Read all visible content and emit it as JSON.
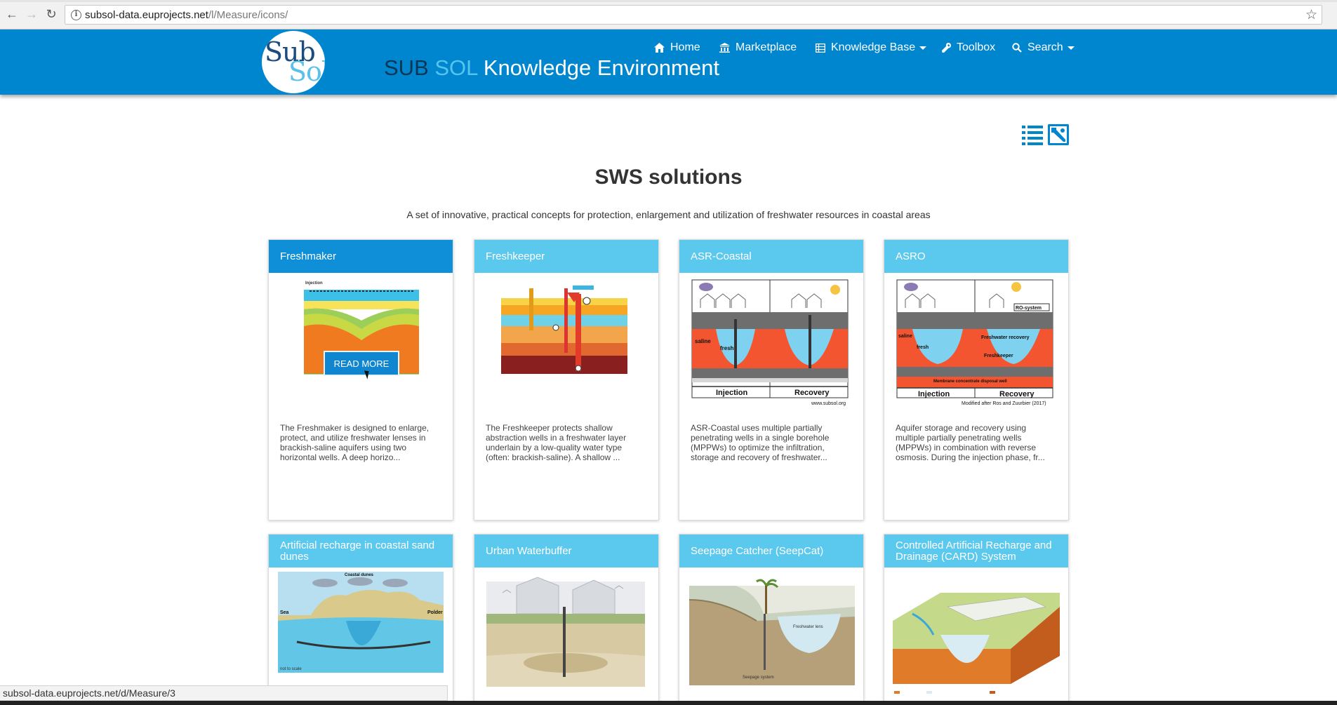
{
  "browser": {
    "url_host": "subsol-data.euprojects.net",
    "url_path": "/l/Measure/icons/",
    "status_url": "subsol-data.euprojects.net/d/Measure/3"
  },
  "header": {
    "logo_sub": "Sub",
    "logo_sol": "Sol",
    "title_part1": "SUB",
    "title_part2": "SOL",
    "title_part3": "Knowledge Environment",
    "nav": [
      {
        "label": "Home",
        "icon": "home-icon"
      },
      {
        "label": "Marketplace",
        "icon": "bank-icon"
      },
      {
        "label": "Knowledge Base",
        "icon": "table-icon"
      },
      {
        "label": "Toolbox",
        "icon": "wrench-icon"
      },
      {
        "label": "Search",
        "icon": "search-icon"
      }
    ]
  },
  "main": {
    "title": "SWS solutions",
    "subtitle": "A set of innovative, practical concepts for protection, enlargement and utilization of freshwater resources in coastal areas",
    "read_more": "READ MORE",
    "cards": [
      {
        "title": "Freshmaker",
        "desc": "The Freshmaker is designed to enlarge, protect, and utilize freshwater lenses in brackish-saline aquifers using two horizontal wells. A deep horizo..."
      },
      {
        "title": "Freshkeeper",
        "desc": "The Freshkeeper protects shallow abstraction wells in a freshwater layer underlain by a low-quality water type (often: brackish-saline). A shallow ..."
      },
      {
        "title": "ASR-Coastal",
        "desc": "ASR-Coastal uses multiple partially penetrating wells in a single borehole (MPPWs) to optimize the infiltration, storage and recovery of freshwater..."
      },
      {
        "title": "ASRO",
        "desc": "Aquifer storage and recovery using multiple partially penetrating wells (MPPWs) in combination with reverse osmosis. During the injection phase, fr..."
      },
      {
        "title": "Artificial recharge in coastal sand dunes",
        "desc": ""
      },
      {
        "title": "Urban Waterbuffer",
        "desc": ""
      },
      {
        "title": "Seepage Catcher (SeepCat)",
        "desc": ""
      },
      {
        "title": "Controlled Artificial Recharge and Drainage (CARD) System",
        "desc": ""
      }
    ],
    "diagram_labels": {
      "injection": "Injection",
      "recovery": "Recovery",
      "fresh": "fresh",
      "saline": "saline",
      "ro_system": "RO-system",
      "freshwater_recovery": "Freshwater recovery",
      "freshkeeper": "Freshkeeper",
      "membrane": "Membrane concentrate disposal well",
      "modified": "Modified after Ros and Zuurbier (2017)",
      "www": "www.subsol.org",
      "coastal_dunes": "Coastal dunes",
      "sea": "Sea",
      "polder": "Polder",
      "not_to_scale": "not to scale",
      "freshwater_lens": "Freshwater lens",
      "seepage_system": "Seepage system"
    }
  },
  "colors": {
    "brand": "#0086cf",
    "card_header_active": "#0f8fd8",
    "card_header": "#5bc8ee"
  }
}
